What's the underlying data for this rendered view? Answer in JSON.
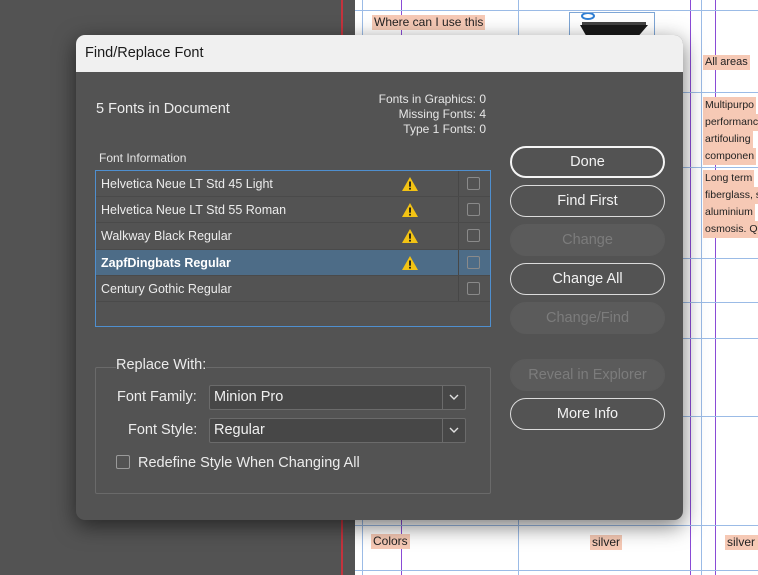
{
  "background_document": {
    "cells": [
      "Where can I use this",
      "All areas",
      "Multipurpo",
      "performanc",
      "artifouling",
      "componen",
      "Long term",
      "fiberglass, s",
      "aluminium",
      "osmosis. Q",
      "Colors",
      "silver",
      "silver g"
    ]
  },
  "dialog": {
    "title": "Find/Replace Font",
    "summary": "5 Fonts in Document",
    "stats": {
      "graphics": "Fonts in Graphics: 0",
      "missing": "Missing Fonts: 4",
      "type1": "Type 1 Fonts: 0"
    },
    "list_header": "Font Information",
    "fonts": [
      {
        "name": "Helvetica Neue LT Std 45 Light",
        "warning": true,
        "selected": false,
        "checked": false
      },
      {
        "name": "Helvetica Neue LT Std 55 Roman",
        "warning": true,
        "selected": false,
        "checked": false
      },
      {
        "name": "Walkway Black Regular",
        "warning": true,
        "selected": false,
        "checked": false
      },
      {
        "name": "ZapfDingbats Regular",
        "warning": true,
        "selected": true,
        "checked": false
      },
      {
        "name": "Century Gothic Regular",
        "warning": false,
        "selected": false,
        "checked": false
      }
    ],
    "replace": {
      "title": "Replace With:",
      "family_label": "Font Family:",
      "family_value": "Minion Pro",
      "style_label": "Font Style:",
      "style_value": "Regular",
      "redefine_label": "Redefine Style When Changing All",
      "redefine_checked": false
    },
    "buttons": {
      "done": "Done",
      "find_first": "Find First",
      "change": "Change",
      "change_all": "Change All",
      "change_find": "Change/Find",
      "reveal": "Reveal in Explorer",
      "more_info": "More Info"
    }
  },
  "colors": {
    "accent": "#4f8fcf",
    "selection": "#4d6c87",
    "warning": "#f3c313",
    "dialog_bg": "#535353",
    "highlight_text_bg": "#f6c9b5"
  }
}
